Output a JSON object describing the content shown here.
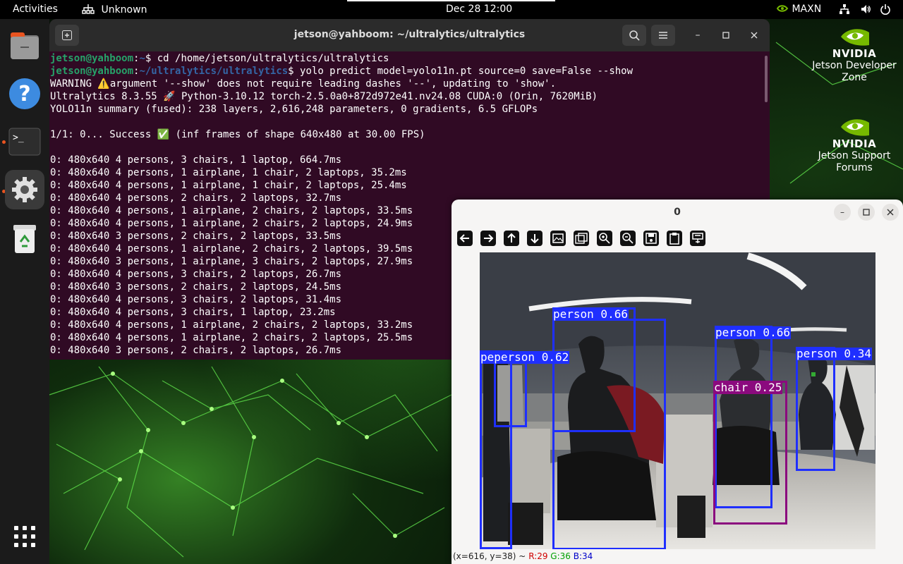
{
  "topbar": {
    "activities": "Activities",
    "network_label": "Unknown",
    "clock": "Dec 28  12:00",
    "power_mode": "MAXN",
    "icons": [
      "network-icon",
      "volume-icon",
      "power-icon"
    ]
  },
  "dock": {
    "items": [
      {
        "name": "files",
        "icon": "files-icon"
      },
      {
        "name": "help",
        "icon": "help-icon",
        "glyph": "?"
      },
      {
        "name": "terminal",
        "icon": "terminal-icon",
        "glyph": ">_"
      },
      {
        "name": "settings",
        "icon": "gear-icon"
      },
      {
        "name": "trash",
        "icon": "trash-icon"
      },
      {
        "name": "apps",
        "icon": "app-grid-icon"
      }
    ]
  },
  "desktop": {
    "icons": [
      {
        "brand": "NVIDIA",
        "label": "Jetson Developer Zone"
      },
      {
        "brand": "NVIDIA",
        "label": "Jetson Support Forums"
      }
    ]
  },
  "terminal": {
    "title": "jetson@yahboom: ~/ultralytics/ultralytics",
    "prompt_user": "jetson@yahboom",
    "lines": [
      {
        "type": "prompt",
        "path": "~",
        "cmd": "cd /home/jetson/ultralytics/ultralytics"
      },
      {
        "type": "prompt",
        "path": "~/ultralytics/ultralytics",
        "cmd": "yolo predict model=yolo11n.pt source=0 save=False --show"
      },
      {
        "type": "text",
        "text": "WARNING ⚠️argument '--show' does not require leading dashes '--', updating to 'show'."
      },
      {
        "type": "text",
        "text": "Ultralytics 8.3.55 🚀 Python-3.10.12 torch-2.5.0a0+872d972e41.nv24.08 CUDA:0 (Orin, 7620MiB)"
      },
      {
        "type": "text",
        "text": "YOLO11n summary (fused): 238 layers, 2,616,248 parameters, 0 gradients, 6.5 GFLOPs"
      },
      {
        "type": "text",
        "text": ""
      },
      {
        "type": "text",
        "text": "1/1: 0... Success ✅ (inf frames of shape 640x480 at 30.00 FPS)"
      },
      {
        "type": "text",
        "text": ""
      },
      {
        "type": "text",
        "text": "0: 480x640 4 persons, 3 chairs, 1 laptop, 664.7ms"
      },
      {
        "type": "text",
        "text": "0: 480x640 4 persons, 1 airplane, 1 chair, 2 laptops, 35.2ms"
      },
      {
        "type": "text",
        "text": "0: 480x640 4 persons, 1 airplane, 1 chair, 2 laptops, 25.4ms"
      },
      {
        "type": "text",
        "text": "0: 480x640 4 persons, 2 chairs, 2 laptops, 32.7ms"
      },
      {
        "type": "text",
        "text": "0: 480x640 4 persons, 1 airplane, 2 chairs, 2 laptops, 33.5ms"
      },
      {
        "type": "text",
        "text": "0: 480x640 4 persons, 1 airplane, 2 chairs, 2 laptops, 24.9ms"
      },
      {
        "type": "text",
        "text": "0: 480x640 3 persons, 2 chairs, 2 laptops, 33.5ms"
      },
      {
        "type": "text",
        "text": "0: 480x640 4 persons, 1 airplane, 2 chairs, 2 laptops, 39.5ms"
      },
      {
        "type": "text",
        "text": "0: 480x640 3 persons, 1 airplane, 3 chairs, 2 laptops, 27.9ms"
      },
      {
        "type": "text",
        "text": "0: 480x640 4 persons, 3 chairs, 2 laptops, 26.7ms"
      },
      {
        "type": "text",
        "text": "0: 480x640 3 persons, 2 chairs, 2 laptops, 24.5ms"
      },
      {
        "type": "text",
        "text": "0: 480x640 4 persons, 3 chairs, 2 laptops, 31.4ms"
      },
      {
        "type": "text",
        "text": "0: 480x640 4 persons, 3 chairs, 1 laptop, 23.2ms"
      },
      {
        "type": "text",
        "text": "0: 480x640 4 persons, 1 airplane, 2 chairs, 2 laptops, 33.2ms"
      },
      {
        "type": "text",
        "text": "0: 480x640 4 persons, 1 airplane, 2 chairs, 2 laptops, 25.5ms"
      },
      {
        "type": "text",
        "text": "0: 480x640 3 persons, 2 chairs, 2 laptops, 26.7ms"
      }
    ]
  },
  "viewer": {
    "title": "0",
    "toolbar": [
      "arrow-left-icon",
      "arrow-right-icon",
      "arrow-up-icon",
      "arrow-down-icon",
      "image-icon",
      "image-multiple-icon",
      "zoom-in-icon",
      "zoom-out-icon",
      "save-icon",
      "clipboard-icon",
      "properties-icon"
    ],
    "detections": [
      {
        "label": "person 0.66",
        "color": "#1f2fff"
      },
      {
        "label": "person 0.66",
        "color": "#1f2fff"
      },
      {
        "label": "peperson 0.62",
        "color": "#1f2fff"
      },
      {
        "label": "person 0.34",
        "color": "#1f2fff"
      },
      {
        "label": "chair 0.25",
        "color": "#8b0a7e"
      }
    ],
    "status": {
      "coords": "(x=616, y=38) ~",
      "r": "R:29",
      "g": "G:36",
      "b": "B:34"
    }
  }
}
